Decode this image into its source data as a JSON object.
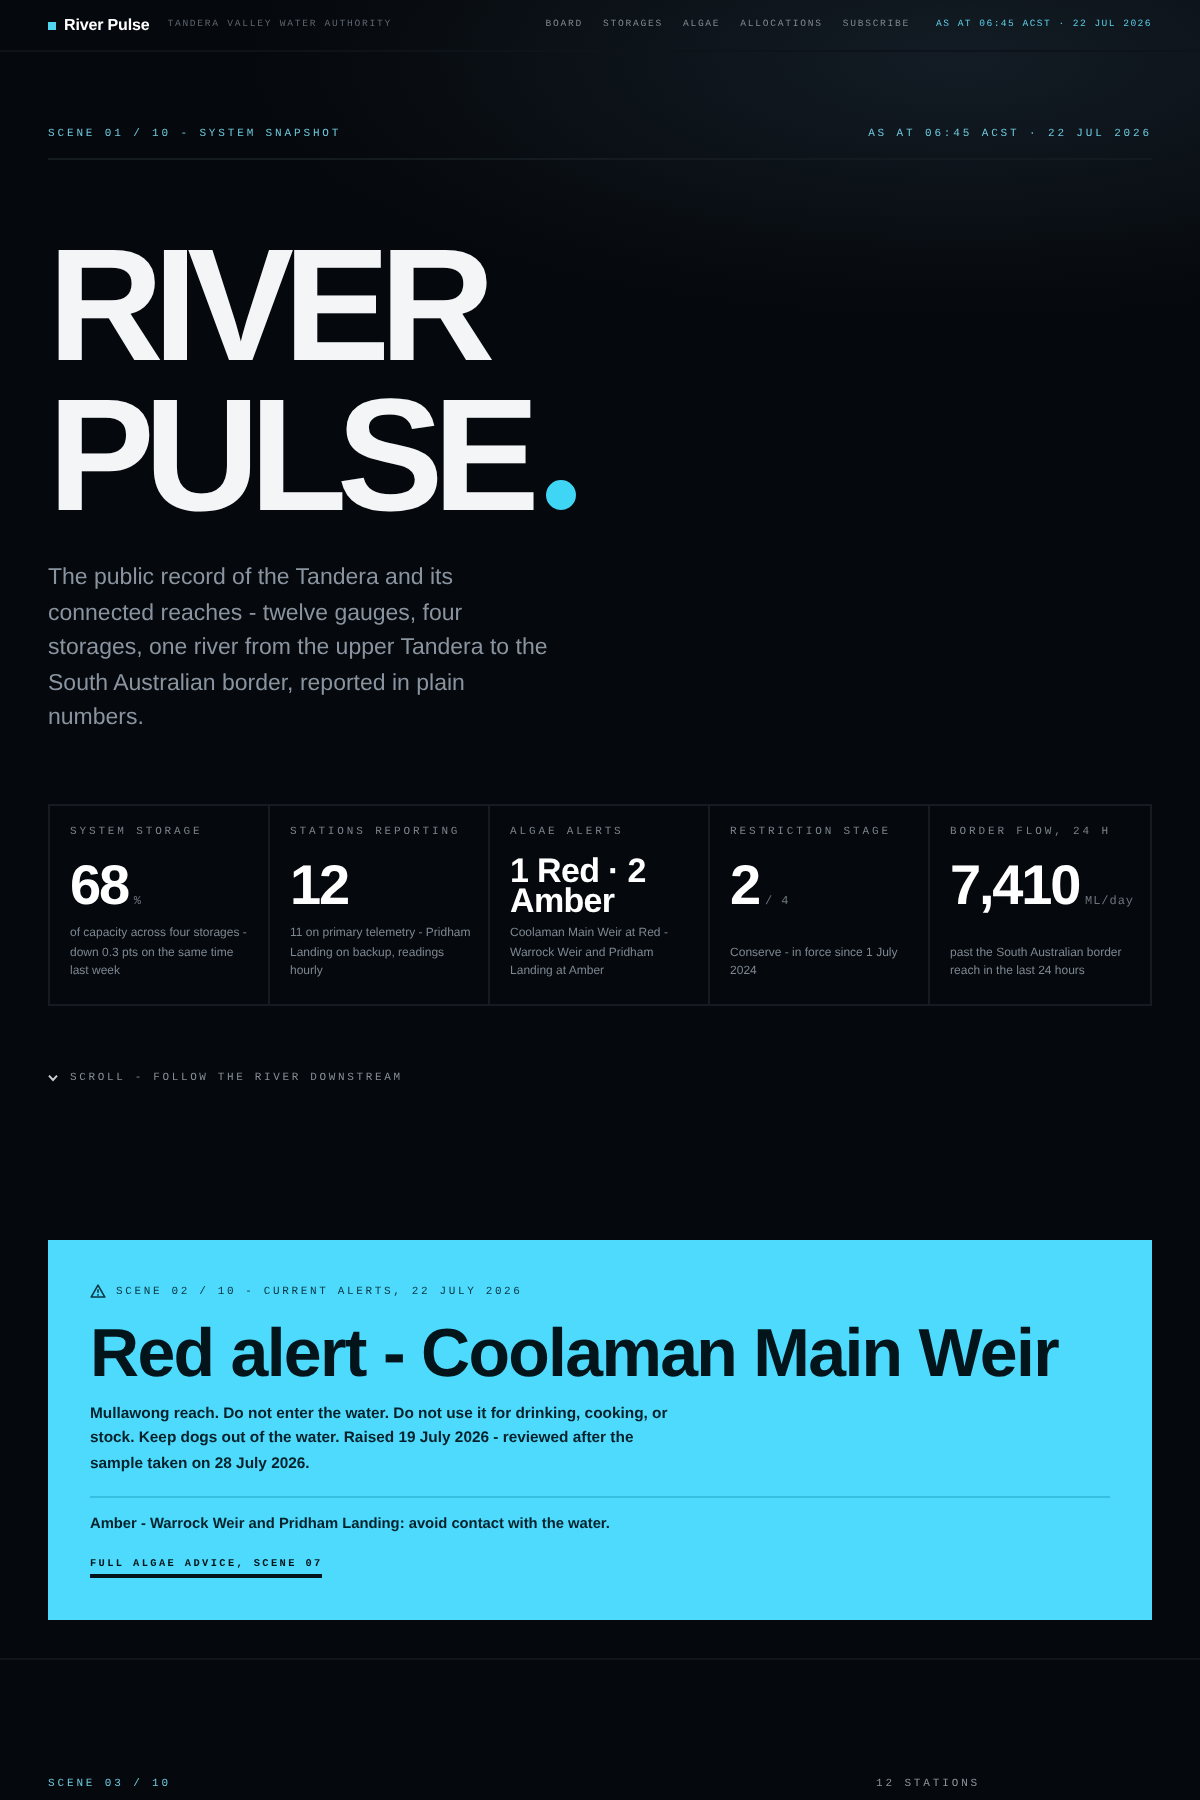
{
  "nav": {
    "brand": "River Pulse",
    "org": "TANDERA VALLEY WATER AUTHORITY",
    "links": [
      "BOARD",
      "STORAGES",
      "ALGAE",
      "ALLOCATIONS",
      "SUBSCRIBE"
    ],
    "timestamp": "AS AT 06:45 ACST · 22 JUL 2026"
  },
  "hero": {
    "scene": "SCENE 01 / 10 - SYSTEM SNAPSHOT",
    "timestamp": "AS AT 06:45 ACST · 22 JUL 2026",
    "title_lines": [
      "RIVER",
      "PULSE"
    ],
    "intro": "The public record of the Tandera and its connected reaches - twelve gauges, four storages, one river from the upper Tandera to the South Australian border, reported in plain numbers."
  },
  "stats": [
    {
      "kind": "figure",
      "label": "SYSTEM STORAGE",
      "value": "68",
      "unit": "%",
      "note": "of capacity across four storages - down 0.3 pts on the same time last week"
    },
    {
      "kind": "figure",
      "label": "STATIONS REPORTING",
      "value": "12",
      "note": "11 on primary telemetry - Pridham Landing on backup, readings hourly"
    },
    {
      "kind": "phrase",
      "label": "ALGAE ALERTS",
      "value": "1 Red · 2 Amber",
      "note": "Coolaman Main Weir at Red - Warrock Weir and Pridham Landing at Amber"
    },
    {
      "kind": "figure",
      "label": "RESTRICTION STAGE",
      "value": "2",
      "unit": "/ 4",
      "note": "Conserve - in force since 1 July 2024"
    },
    {
      "kind": "figure",
      "label": "BORDER FLOW, 24 H",
      "value": "7,410",
      "unit": "ML/day",
      "note": "past the South Australian border reach in the last 24 hours"
    }
  ],
  "scroll_hint": "SCROLL - FOLLOW THE RIVER DOWNSTREAM",
  "alert": {
    "scene": "SCENE 02 / 10 - CURRENT ALERTS, 22 JULY 2026",
    "title": "Red alert - Coolaman Main Weir",
    "body": "Mullawong reach. Do not enter the water. Do not use it for drinking, cooking, or stock. Keep dogs out of the water. Raised 19 July 2026 - reviewed after the sample taken on 28 July 2026.",
    "secondary": "Amber - Warrock Weir and Pridham Landing: avoid contact with the water.",
    "link": "FULL ALGAE ADVICE, SCENE 07"
  },
  "next_scene": {
    "scene": "SCENE 03 / 10",
    "count": "12 STATIONS"
  }
}
